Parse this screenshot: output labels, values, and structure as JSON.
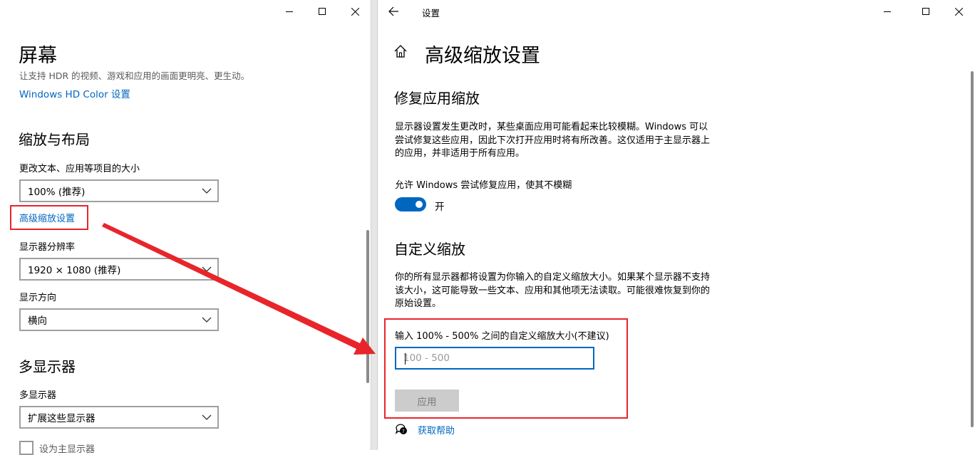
{
  "left_window": {
    "title_controls": {
      "minimize_icon": "minimize-icon",
      "maximize_icon": "maximize-icon",
      "close_icon": "close-icon"
    },
    "page_title": "屏幕",
    "hdr_description": "让支持 HDR 的视频、游戏和应用的画面更明亮、更生动。",
    "hdr_link": "Windows HD Color 设置",
    "scale_section": {
      "heading": "缩放与布局",
      "scale_label": "更改文本、应用等项目的大小",
      "scale_value": "100% (推荐)",
      "advanced_link": "高级缩放设置",
      "resolution_label": "显示器分辨率",
      "resolution_value": "1920 × 1080 (推荐)",
      "orientation_label": "显示方向",
      "orientation_value": "横向"
    },
    "multi_section": {
      "heading": "多显示器",
      "label": "多显示器",
      "value": "扩展这些显示器",
      "checkbox_label": "设为主显示器"
    }
  },
  "right_window": {
    "title": "设置",
    "back_icon": "back-arrow-icon",
    "home_icon": "home-icon",
    "page_title": "高级缩放设置",
    "fix_section": {
      "heading": "修复应用缩放",
      "description": "显示器设置发生更改时，某些桌面应用可能看起来比较模糊。Windows 可以尝试修复这些应用，因此下次打开应用时将有所改善。这仅适用于主显示器上的应用，并非适用于所有应用。",
      "toggle_label": "允许 Windows 尝试修复应用，使其不模糊",
      "toggle_state": "开"
    },
    "custom_section": {
      "heading": "自定义缩放",
      "description": "你的所有显示器都将设置为你输入的自定义缩放大小。如果某个显示器不支持该大小，这可能导致一些文本、应用和其他项无法读取。可能很难恢复到你的原始设置。",
      "input_label": "输入 100% - 500% 之间的自定义缩放大小(不建议)",
      "input_placeholder": "100 - 500",
      "apply_button": "应用",
      "help_link": "获取帮助"
    }
  },
  "colors": {
    "accent": "#0067c0",
    "highlight": "#e8252a"
  }
}
